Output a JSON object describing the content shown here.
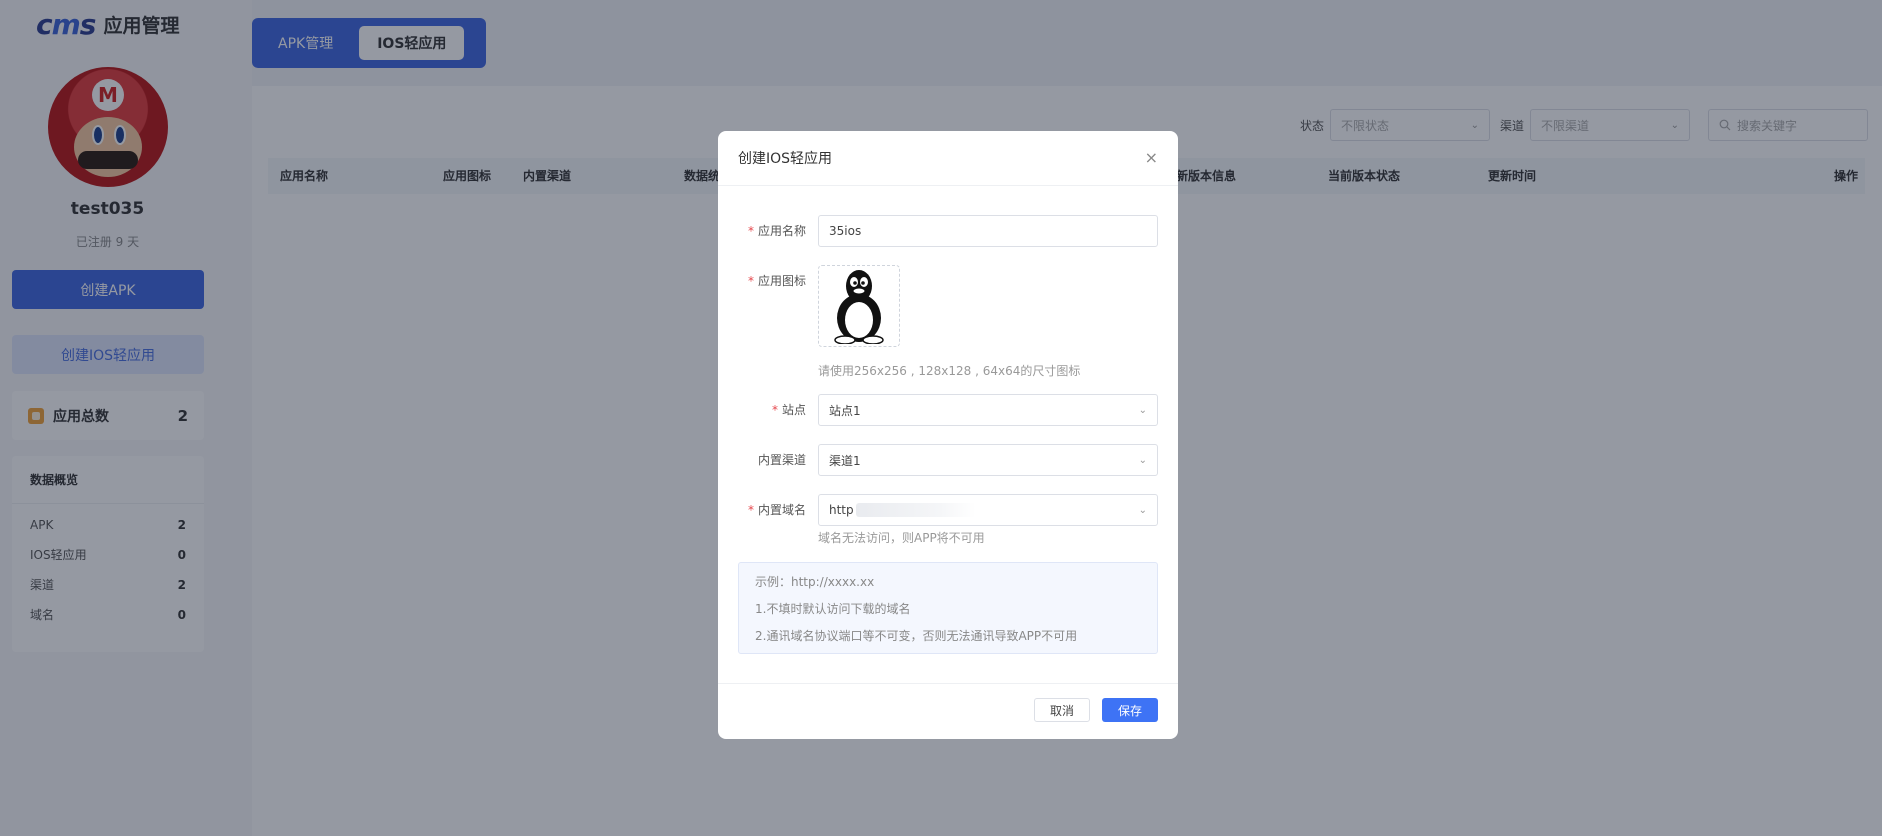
{
  "app": {
    "logo_mark": "cms",
    "logo_text": "应用管理"
  },
  "user": {
    "name": "test035",
    "registered": "已注册 9 天",
    "avatar_badge": "M"
  },
  "sidebar": {
    "create_apk": "创建APK",
    "create_ios": "创建IOS轻应用",
    "total_label": "应用总数",
    "total_value": "2",
    "overview_title": "数据概览",
    "overview": [
      {
        "label": "APK",
        "value": "2"
      },
      {
        "label": "IOS轻应用",
        "value": "0"
      },
      {
        "label": "渠道",
        "value": "2"
      },
      {
        "label": "域名",
        "value": "0"
      }
    ]
  },
  "tabs": [
    {
      "label": "APK管理",
      "active": false
    },
    {
      "label": "IOS轻应用",
      "active": true
    }
  ],
  "filters": {
    "status_label": "状态",
    "status_placeholder": "不限状态",
    "channel_label": "渠道",
    "channel_placeholder": "不限渠道",
    "search_placeholder": "搜索关键字"
  },
  "table": {
    "columns": [
      "应用名称",
      "应用图标",
      "内置渠道",
      "数据统",
      "新版本信息",
      "当前版本状态",
      "更新时间",
      "操作"
    ]
  },
  "modal": {
    "title": "创建IOS轻应用",
    "close": "×",
    "fields": {
      "name_label": "应用名称",
      "name_value": "35ios",
      "icon_label": "应用图标",
      "icon_hint": "请使用256x256 , 128x128 , 64x64的尺寸图标",
      "site_label": "站点",
      "site_value": "站点1",
      "channel_label": "内置渠道",
      "channel_value": "渠道1",
      "domain_label": "内置域名",
      "domain_value": "http",
      "domain_hint": "域名无法访问，则APP将不可用"
    },
    "notice": [
      "示例：http://xxxx.xx",
      "1.不填时默认访问下载的域名",
      "2.通讯域名协议端口等不可变，否则无法通讯导致APP不可用"
    ],
    "cancel": "取消",
    "save": "保存"
  },
  "colors": {
    "primary": "#3e66e0",
    "save_button": "#3e73f5",
    "required": "#e5484d"
  }
}
